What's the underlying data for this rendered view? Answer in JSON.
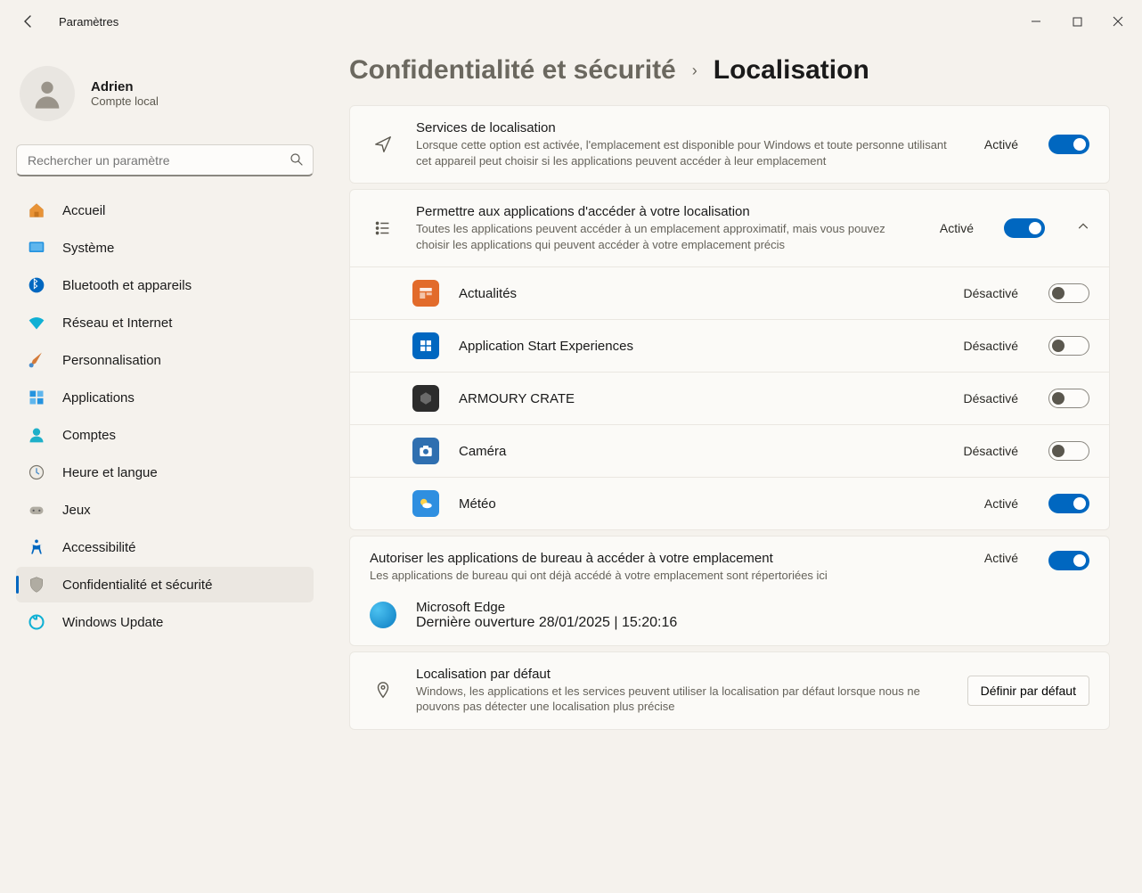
{
  "window": {
    "title": "Paramètres"
  },
  "user": {
    "name": "Adrien",
    "account": "Compte local"
  },
  "search": {
    "placeholder": "Rechercher un paramètre"
  },
  "nav": [
    {
      "label": "Accueil",
      "icon": "home"
    },
    {
      "label": "Système",
      "icon": "system"
    },
    {
      "label": "Bluetooth et appareils",
      "icon": "bluetooth"
    },
    {
      "label": "Réseau et Internet",
      "icon": "wifi"
    },
    {
      "label": "Personnalisation",
      "icon": "brush"
    },
    {
      "label": "Applications",
      "icon": "apps"
    },
    {
      "label": "Comptes",
      "icon": "account"
    },
    {
      "label": "Heure et langue",
      "icon": "time"
    },
    {
      "label": "Jeux",
      "icon": "games"
    },
    {
      "label": "Accessibilité",
      "icon": "accessibility"
    },
    {
      "label": "Confidentialité et sécurité",
      "icon": "privacy",
      "active": true
    },
    {
      "label": "Windows Update",
      "icon": "update"
    }
  ],
  "breadcrumb": {
    "parent": "Confidentialité et sécurité",
    "current": "Localisation"
  },
  "states": {
    "on": "Activé",
    "off": "Désactivé"
  },
  "sections": {
    "locationServices": {
      "title": "Services de localisation",
      "desc": "Lorsque cette option est activée, l'emplacement est disponible pour Windows et toute personne utilisant cet appareil peut choisir si les applications peuvent accéder à leur emplacement",
      "enabled": true
    },
    "appsAccess": {
      "title": "Permettre aux applications d'accéder à votre localisation",
      "desc": "Toutes les applications peuvent accéder à un emplacement approximatif, mais vous pouvez choisir les applications qui peuvent accéder à votre emplacement précis",
      "enabled": true,
      "expanded": true,
      "apps": [
        {
          "name": "Actualités",
          "enabled": false,
          "color": "#e26b2b",
          "glyph": "news"
        },
        {
          "name": "Application Start Experiences",
          "enabled": false,
          "color": "#0067c0",
          "glyph": "start"
        },
        {
          "name": "ARMOURY CRATE",
          "enabled": false,
          "color": "#2c2c2c",
          "glyph": "armoury"
        },
        {
          "name": "Caméra",
          "enabled": false,
          "color": "#2f6fb0",
          "glyph": "camera"
        },
        {
          "name": "Météo",
          "enabled": true,
          "color": "#2f8fe0",
          "glyph": "weather"
        }
      ]
    },
    "desktopApps": {
      "title": "Autoriser les applications de bureau à accéder à votre emplacement",
      "desc": "Les applications de bureau qui ont déjà accédé à votre emplacement sont répertoriées ici",
      "enabled": true,
      "listed": [
        {
          "name": "Microsoft Edge",
          "last": "Dernière ouverture 28/01/2025  |  15:20:16",
          "color": "#1c9cd8"
        }
      ]
    },
    "defaultLocation": {
      "title": "Localisation par défaut",
      "desc": "Windows, les applications et les services peuvent utiliser la localisation par défaut lorsque nous ne pouvons pas détecter une localisation plus précise",
      "button": "Définir par défaut"
    }
  }
}
